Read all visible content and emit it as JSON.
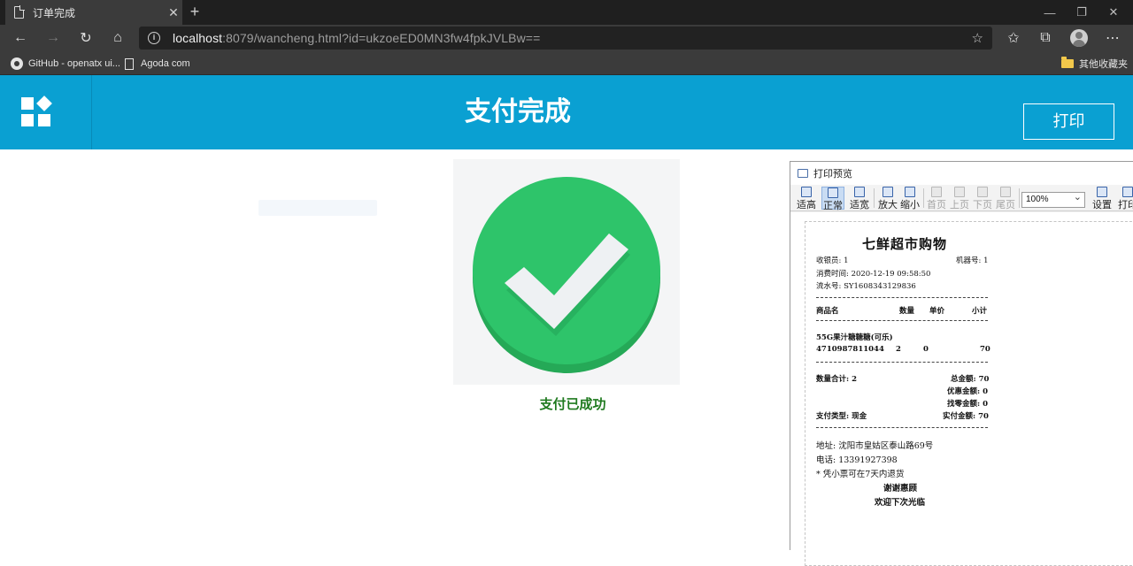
{
  "browser": {
    "tab_title": "订单完成",
    "tab_close": "✕",
    "new_tab": "+",
    "url_host": "localhost",
    "url_rest": ":8079/wancheng.html?id=ukzoeED0MN3fw4fpkJVLBw==",
    "bookmarks": [
      {
        "label": "GitHub - openatx ui...",
        "icon": "github-icon"
      },
      {
        "label": "Agoda com",
        "icon": "page-icon"
      }
    ],
    "other_bookmarks": "其他收藏夹"
  },
  "header": {
    "title": "支付完成",
    "print_button": "打印"
  },
  "main": {
    "success_message": "支付已成功",
    "accent_color": "#2ec46a"
  },
  "preview": {
    "window_title": "打印预览",
    "tools": [
      "适高",
      "正常",
      "适宽",
      "放大",
      "缩小",
      "首页",
      "上页",
      "下页",
      "尾页",
      "设置",
      "打印"
    ],
    "zoom": "100%"
  },
  "receipt": {
    "store_name": "七鲜超市购物",
    "cashier": "收银员: 1",
    "machine": "机器号: 1",
    "time": "消费时间: 2020-12-19 09:58:50",
    "serial": "流水号: SY1608343129836",
    "col_name": "商品名",
    "col_qty": "数量",
    "col_price": "单价",
    "col_subtotal": "小计",
    "item_name": "55G果汁糖糖糖(可乐)",
    "item_code": "4710987811044",
    "item_qty": "2",
    "item_price": "0",
    "item_subtotal": "70",
    "qty_total": "数量合计: 2",
    "total_amount": "总金额: 70",
    "discount": "优惠金额: 0",
    "rounding": "找零金额: 0",
    "pay_type": "支付类型: 现金",
    "paid": "实付金额: 70",
    "address": "地址: 沈阳市皇姑区泰山路69号",
    "phone": "电话: 13391927398",
    "note": "* 凭小票可在7天内退货",
    "thanks": "谢谢惠顾",
    "welcome": "欢迎下次光临"
  }
}
